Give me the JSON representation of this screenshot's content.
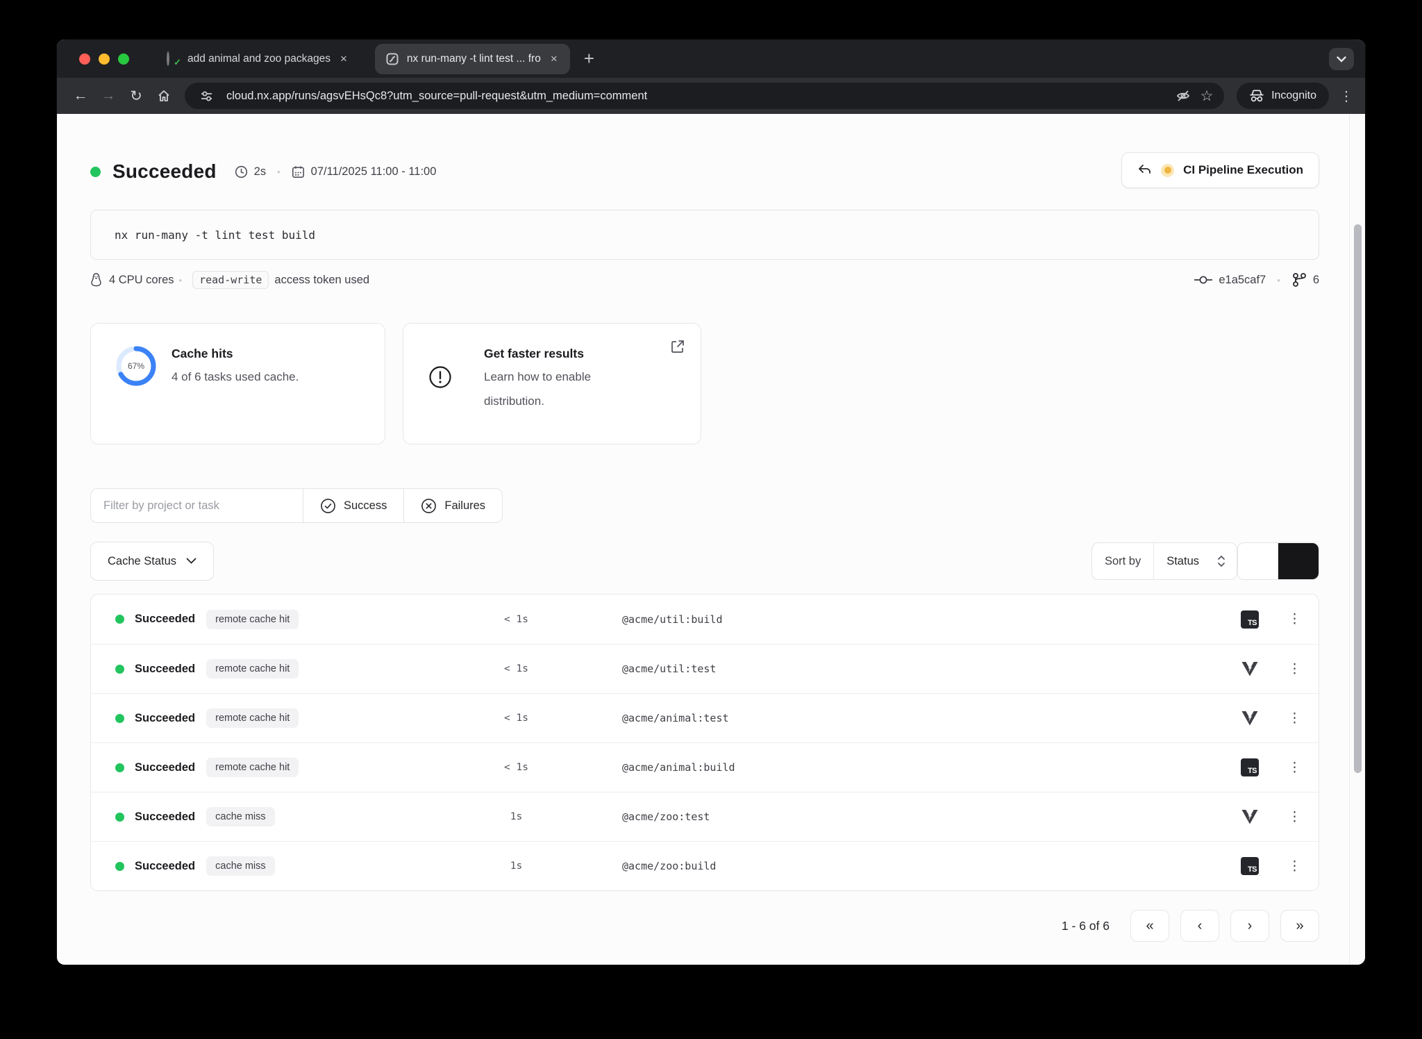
{
  "browser": {
    "tabs": [
      {
        "label": "add animal and zoo packages"
      },
      {
        "label": "nx run-many -t lint test ... fro"
      }
    ],
    "url": "cloud.nx.app/runs/agsvEHsQc8?utm_source=pull-request&utm_medium=comment",
    "incognito_label": "Incognito"
  },
  "header": {
    "status": "Succeeded",
    "duration": "2s",
    "date_range": "07/11/2025 11:00 - 11:00",
    "pipeline_label": "CI Pipeline Execution"
  },
  "command": {
    "text": "nx run-many -t lint test build"
  },
  "meta": {
    "cpu": "4 CPU cores",
    "token_chip": "read-write",
    "token_text": "access token used",
    "commit": "e1a5caf7",
    "branches": "6"
  },
  "cards": {
    "cache": {
      "percent_label": "67%",
      "percent_value": 67,
      "title": "Cache hits",
      "subtitle": "4 of 6 tasks used cache."
    },
    "distribution": {
      "title": "Get faster results",
      "line1": "Learn how to enable",
      "line2": "distribution."
    }
  },
  "filters": {
    "placeholder": "Filter by project or task",
    "success_label": "Success",
    "failures_label": "Failures"
  },
  "controls": {
    "cache_status_label": "Cache Status",
    "sort_by_label": "Sort by",
    "sort_value": "Status"
  },
  "table": {
    "ts_badge": "TS",
    "rows": [
      {
        "status": "Succeeded",
        "cache": "remote cache hit",
        "time": "< 1s",
        "task": "@acme/util:build",
        "tool": "typescript"
      },
      {
        "status": "Succeeded",
        "cache": "remote cache hit",
        "time": "< 1s",
        "task": "@acme/util:test",
        "tool": "vitest"
      },
      {
        "status": "Succeeded",
        "cache": "remote cache hit",
        "time": "< 1s",
        "task": "@acme/animal:test",
        "tool": "vitest"
      },
      {
        "status": "Succeeded",
        "cache": "remote cache hit",
        "time": "< 1s",
        "task": "@acme/animal:build",
        "tool": "typescript"
      },
      {
        "status": "Succeeded",
        "cache": "cache miss",
        "time": "1s",
        "task": "@acme/zoo:test",
        "tool": "vitest"
      },
      {
        "status": "Succeeded",
        "cache": "cache miss",
        "time": "1s",
        "task": "@acme/zoo:build",
        "tool": "typescript"
      }
    ]
  },
  "pagination": {
    "label": "1 - 6 of 6",
    "first": "«",
    "prev": "‹",
    "next": "›",
    "last": "»"
  },
  "glyphs": {
    "close": "×",
    "plus": "+",
    "back": "←",
    "forward": "→",
    "reload": "↻",
    "star": "☆",
    "kebab": "⋮",
    "dot": "•"
  },
  "colors": {
    "accent_blue": "#3b82f6",
    "success_green": "#21c45d",
    "pending_amber": "#f0b541"
  }
}
